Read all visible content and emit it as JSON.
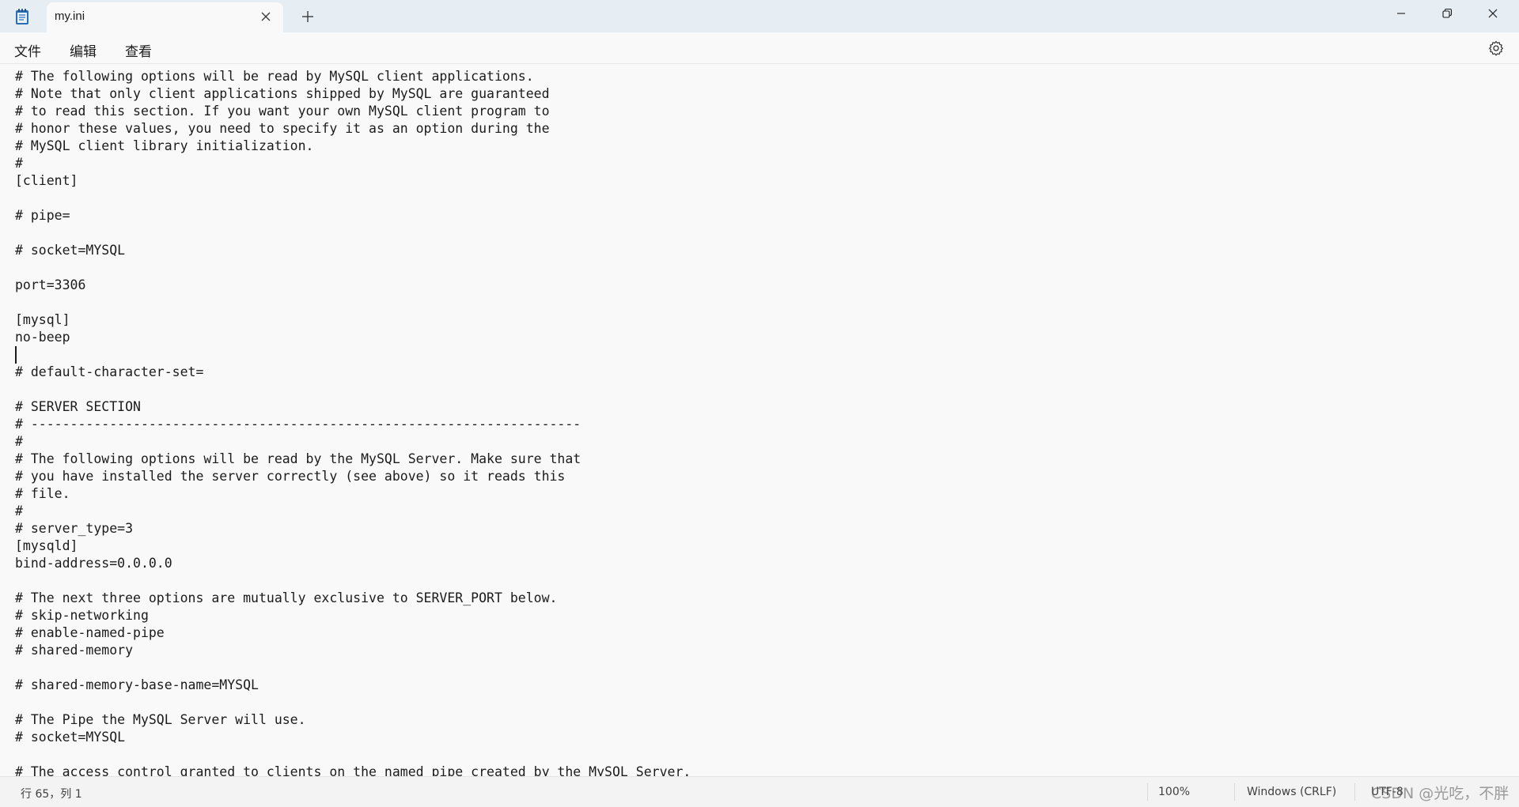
{
  "titlebar": {
    "tab_title": "my.ini"
  },
  "icons": {
    "app": "notepad-icon",
    "tab_close": "close-icon",
    "new_tab": "plus-icon",
    "minimize": "minimize-icon",
    "maximize": "restore-icon",
    "close": "close-icon",
    "settings": "gear-icon"
  },
  "menu": {
    "file": "文件",
    "edit": "编辑",
    "view": "查看"
  },
  "editor": {
    "lines": [
      "# The following options will be read by MySQL client applications.",
      "# Note that only client applications shipped by MySQL are guaranteed",
      "# to read this section. If you want your own MySQL client program to",
      "# honor these values, you need to specify it as an option during the",
      "# MySQL client library initialization.",
      "#",
      "[client]",
      "",
      "# pipe=",
      "",
      "# socket=MYSQL",
      "",
      "port=3306",
      "",
      "[mysql]",
      "no-beep",
      "",
      "# default-character-set=",
      "",
      "# SERVER SECTION",
      "# ----------------------------------------------------------------------",
      "#",
      "# The following options will be read by the MySQL Server. Make sure that",
      "# you have installed the server correctly (see above) so it reads this",
      "# file.",
      "#",
      "# server_type=3",
      "[mysqld]",
      "bind-address=0.0.0.0",
      "",
      "# The next three options are mutually exclusive to SERVER_PORT below.",
      "# skip-networking",
      "# enable-named-pipe",
      "# shared-memory",
      "",
      "# shared-memory-base-name=MYSQL",
      "",
      "# The Pipe the MySQL Server will use.",
      "# socket=MYSQL",
      "",
      "# The access control granted to clients on the named pipe created by the MySQL Server."
    ]
  },
  "statusbar": {
    "position": "行 65，列 1",
    "zoom": "100%",
    "line_ending": "Windows (CRLF)",
    "encoding": "UTF-8",
    "watermark": "CSDN @光吃，不胖"
  }
}
